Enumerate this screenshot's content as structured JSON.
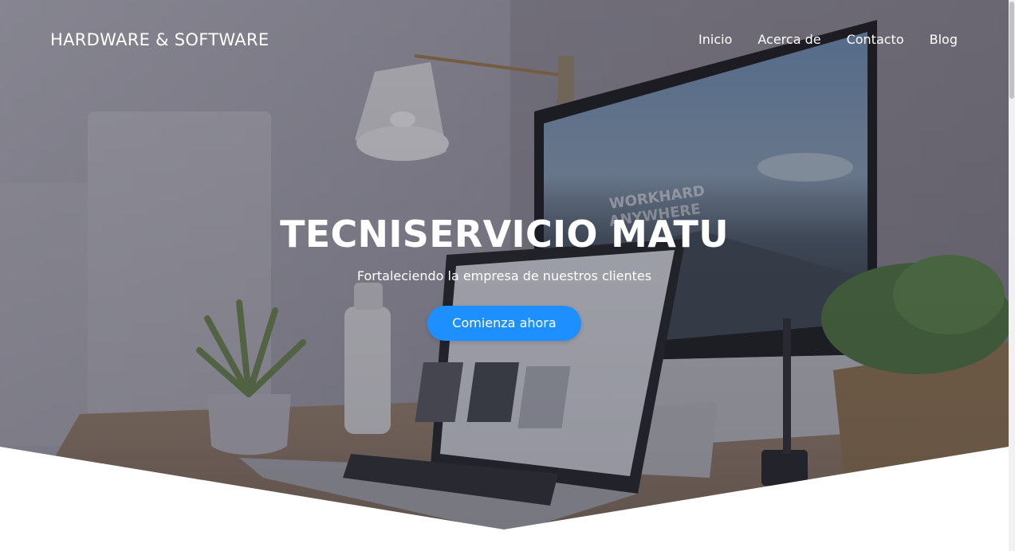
{
  "header": {
    "brand": "HARDWARE & SOFTWARE",
    "nav": [
      {
        "label": "Inicio"
      },
      {
        "label": "Acerca de"
      },
      {
        "label": "Contacto"
      },
      {
        "label": "Blog"
      }
    ]
  },
  "hero": {
    "title": "TECNISERVICIO MATU",
    "subtitle": "Fortaleciendo la empresa de nuestros clientes",
    "cta_label": "Comienza ahora",
    "screen_text": [
      "WORKHARD",
      "ANYWHERE"
    ]
  },
  "colors": {
    "accent": "#1e8fff",
    "overlay": "#3a3a46"
  },
  "icons": [
    "desk-lamp-icon",
    "imac-icon",
    "laptop-icon",
    "plant-icon",
    "water-bottle-icon"
  ]
}
